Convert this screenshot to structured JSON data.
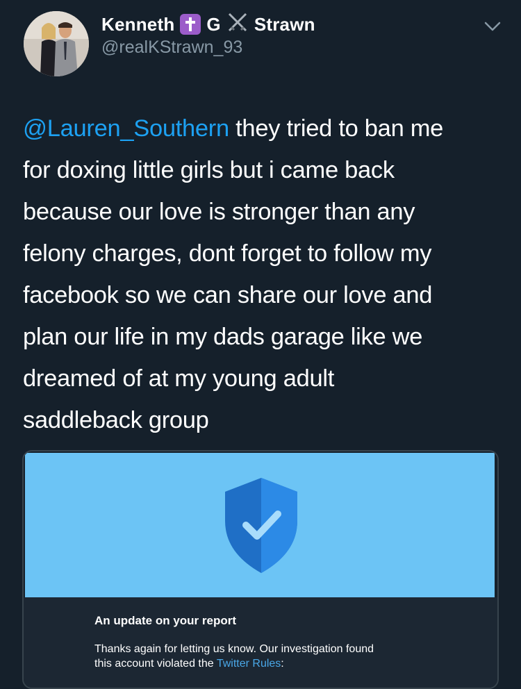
{
  "tweet": {
    "author": {
      "name_first": "Kenneth",
      "name_middle": "G",
      "name_last": "Strawn",
      "handle": "@realKStrawn_93",
      "badge_icons": [
        "cross-icon",
        "crossed-swords-icon"
      ]
    },
    "mention": "@Lauren_Southern",
    "lines": [
      " they tried to ban me",
      "for doxing little girls but i came back",
      "because our love is stronger than any",
      "felony charges, dont forget to follow my",
      "facebook so we can share our love and",
      "plan our life in my dads garage like we",
      "dreamed of at my young adult",
      "saddleback group"
    ],
    "menu_icon": "chevron-down-icon"
  },
  "card": {
    "title": "An update on your report",
    "line1": "Thanks again for letting us know. Our investigation found",
    "line2_prefix": "this account violated the ",
    "line2_link": "Twitter Rules",
    "line2_suffix": ":"
  },
  "colors": {
    "background": "#15202b",
    "link": "#1da1f2",
    "muted": "#8899a6",
    "banner": "#6cc4f5"
  }
}
